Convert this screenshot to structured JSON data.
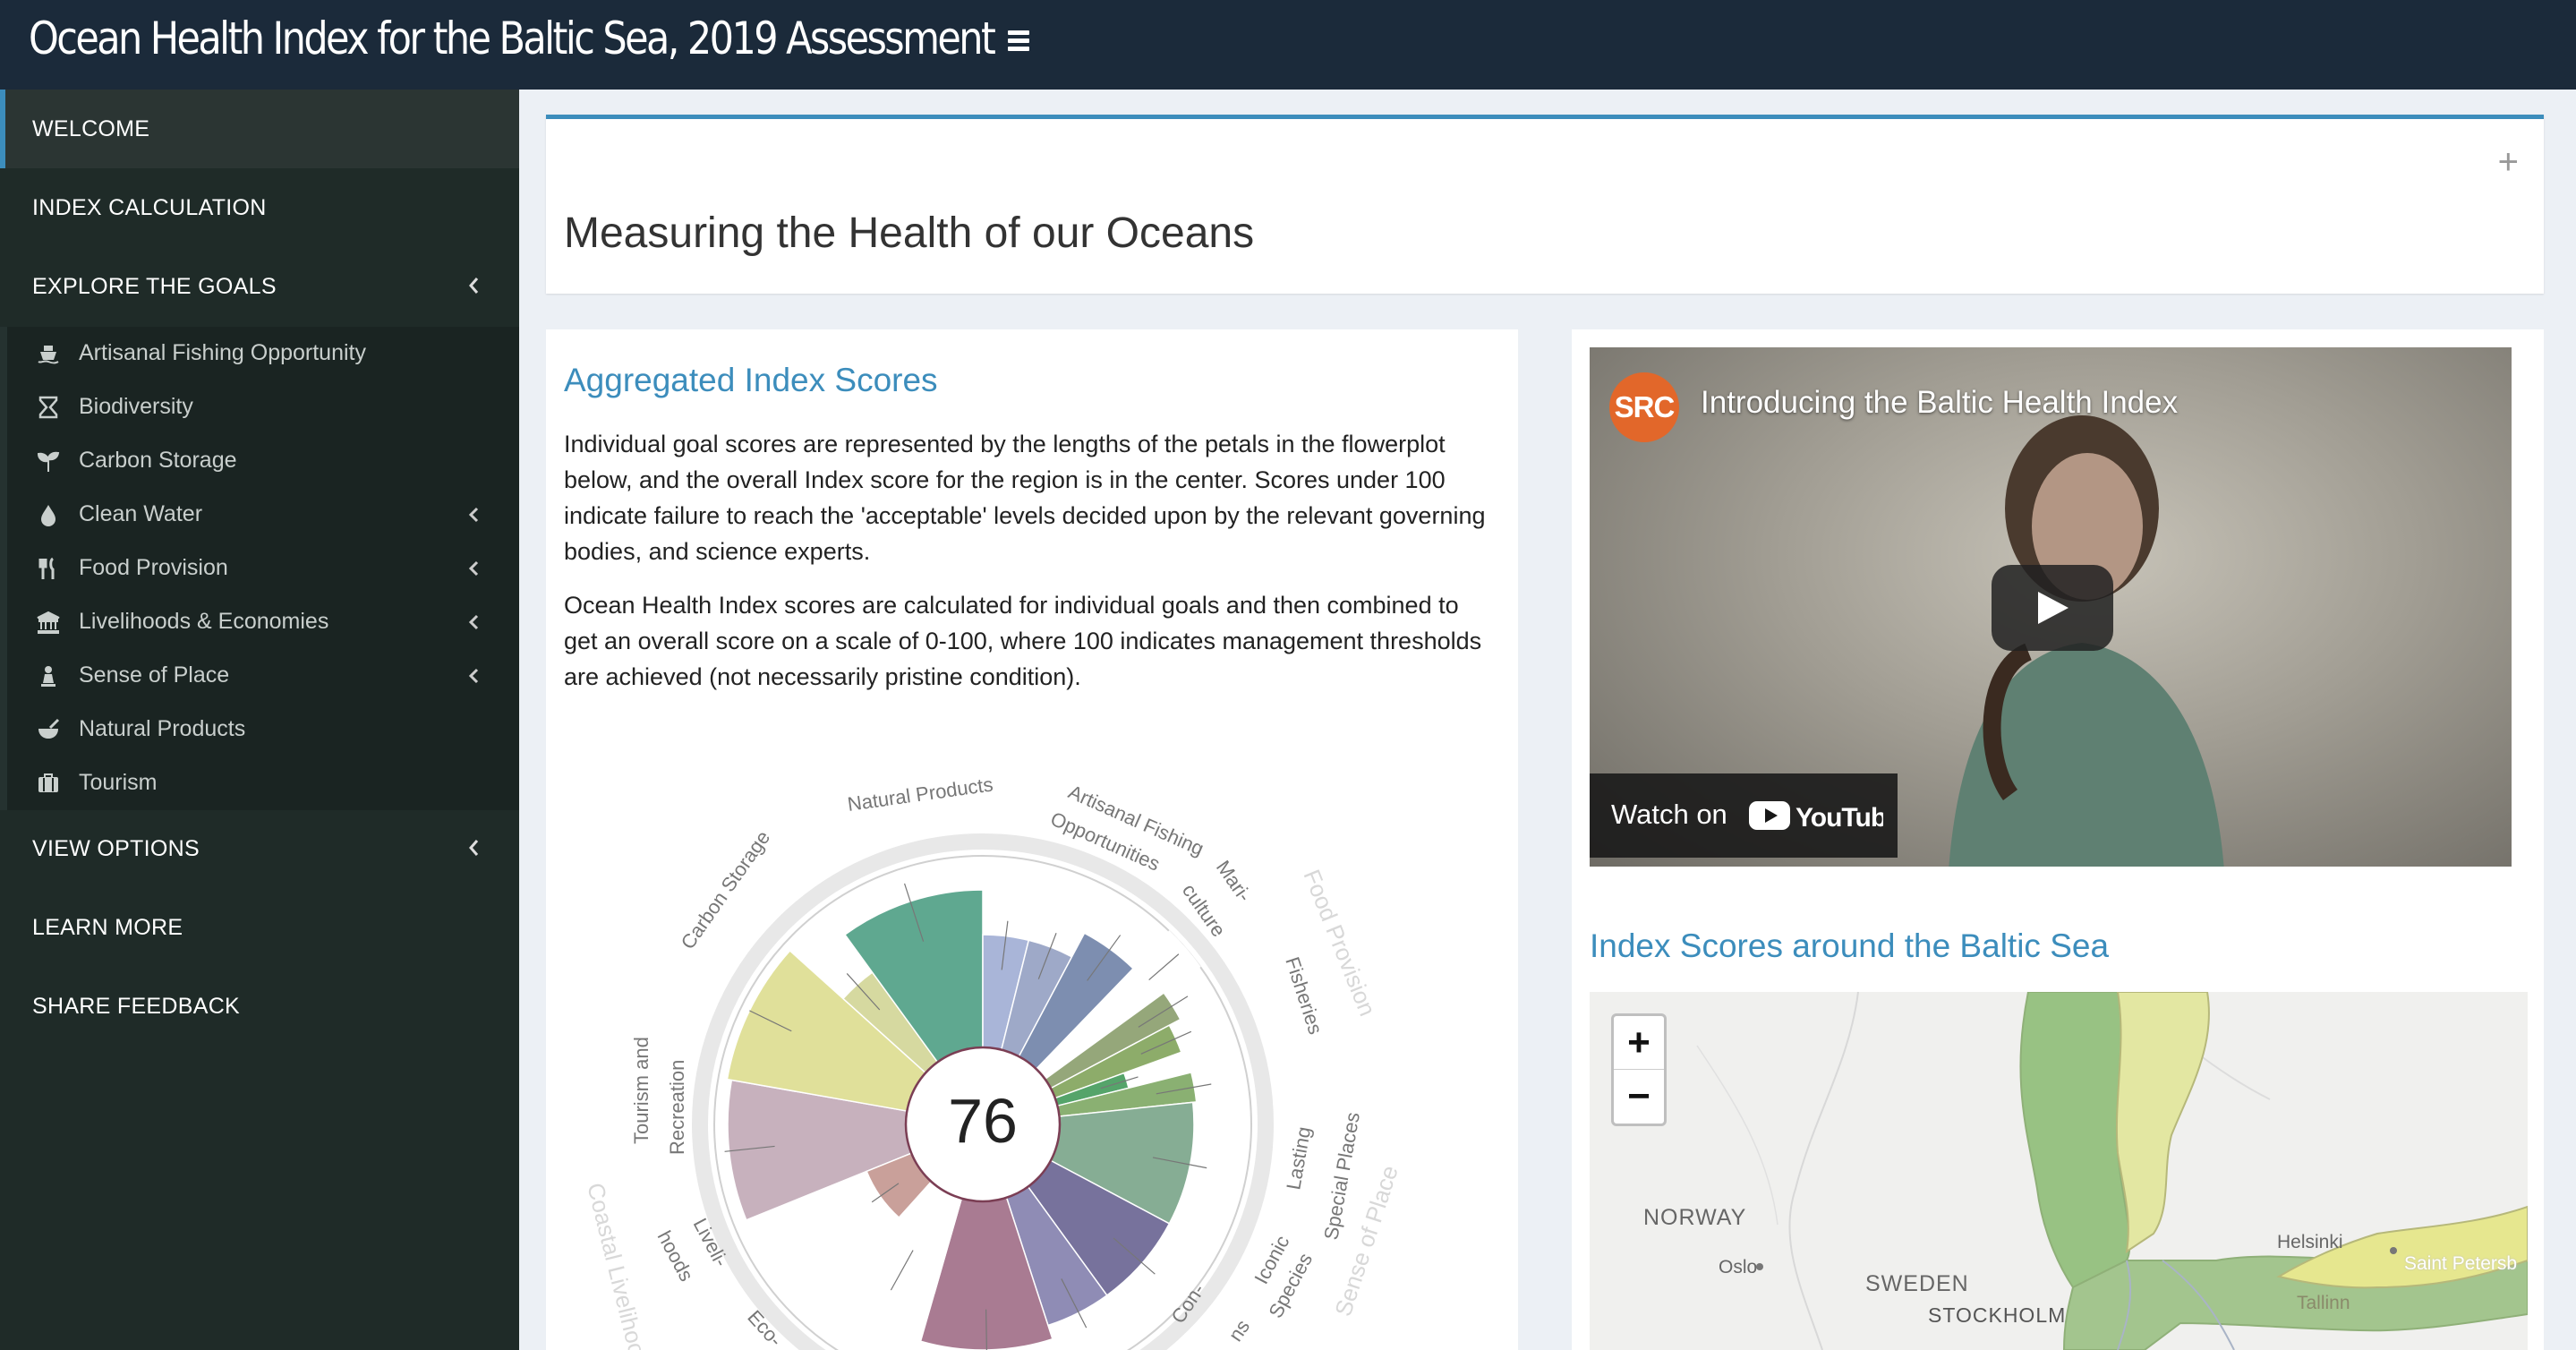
{
  "header": {
    "title": "Ocean Health Index for the Baltic Sea, 2019 Assessment",
    "menu_icon": "hamburger-icon"
  },
  "sidebar": {
    "items": [
      {
        "label": "WELCOME",
        "active": true
      },
      {
        "label": "INDEX CALCULATION"
      },
      {
        "label": "EXPLORE THE GOALS"
      },
      {
        "label": "VIEW OPTIONS"
      },
      {
        "label": "LEARN MORE"
      },
      {
        "label": "SHARE FEEDBACK"
      }
    ],
    "goals": [
      {
        "label": "Artisanal Fishing Opportunity",
        "icon": "ship-icon"
      },
      {
        "label": "Biodiversity",
        "icon": "hourglass-icon"
      },
      {
        "label": "Carbon Storage",
        "icon": "seedling-icon"
      },
      {
        "label": "Clean Water",
        "icon": "tint-icon"
      },
      {
        "label": "Food Provision",
        "icon": "cutlery-icon"
      },
      {
        "label": "Livelihoods & Economies",
        "icon": "bank-icon"
      },
      {
        "label": "Sense of Place",
        "icon": "chess-pawn-icon"
      },
      {
        "label": "Natural Products",
        "icon": "mortar-pestle-icon"
      },
      {
        "label": "Tourism",
        "icon": "suitcase-icon"
      }
    ]
  },
  "main": {
    "heading": "Measuring the Health of our Oceans",
    "scores": {
      "title": "Aggregated Index Scores",
      "p1": "Individual goal scores are represented by the lengths of the petals in the flowerplot below, and the overall Index score for the region is in the center. Scores under 100 indicate failure to reach the 'acceptable' levels decided upon by the relevant governing bodies, and science experts.",
      "p2": "Ocean Health Index scores are calculated for individual goals and then combined to get an overall score on a scale of 0-100, where 100 indicates management thresholds are achieved (not necessarily pristine condition).",
      "index_score": "76"
    },
    "video": {
      "channel": "SRC",
      "title": "Introducing the Baltic Health Index",
      "watch_on": "Watch on",
      "youtube": "YouTube"
    },
    "map": {
      "title": "Index Scores around the Baltic Sea",
      "zoom_in": "+",
      "zoom_out": "−",
      "labels": {
        "norway": "NORWAY",
        "sweden": "SWEDEN",
        "stockholm": "STOCKHOLM",
        "oslo": "Oslo",
        "helsinki": "Helsinki",
        "tallinn": "Tallinn",
        "st_petersburg": "Saint Petersb"
      }
    }
  },
  "flower_labels": {
    "natural_products": "Natural Products",
    "artisanal1": "Artisanal Fishing",
    "artisanal2": "Opportunities",
    "mari1": "Mari-",
    "mari2": "culture",
    "fisheries": "Fisheries",
    "food_provision": "Food Provision",
    "carbon_storage": "Carbon Storage",
    "tourism1": "Tourism and",
    "tourism2": "Recreation",
    "lasting1": "Lasting",
    "lasting2": "Special Places",
    "iconic1": "Iconic",
    "iconic2": "Species",
    "sense_of_place": "Sense of Place",
    "liveli1": "Liveli-",
    "liveli2": "hoods",
    "coastal": "Coastal Livelihoo",
    "eco": "Eco-",
    "con": "Con-",
    "ns": "ns"
  }
}
